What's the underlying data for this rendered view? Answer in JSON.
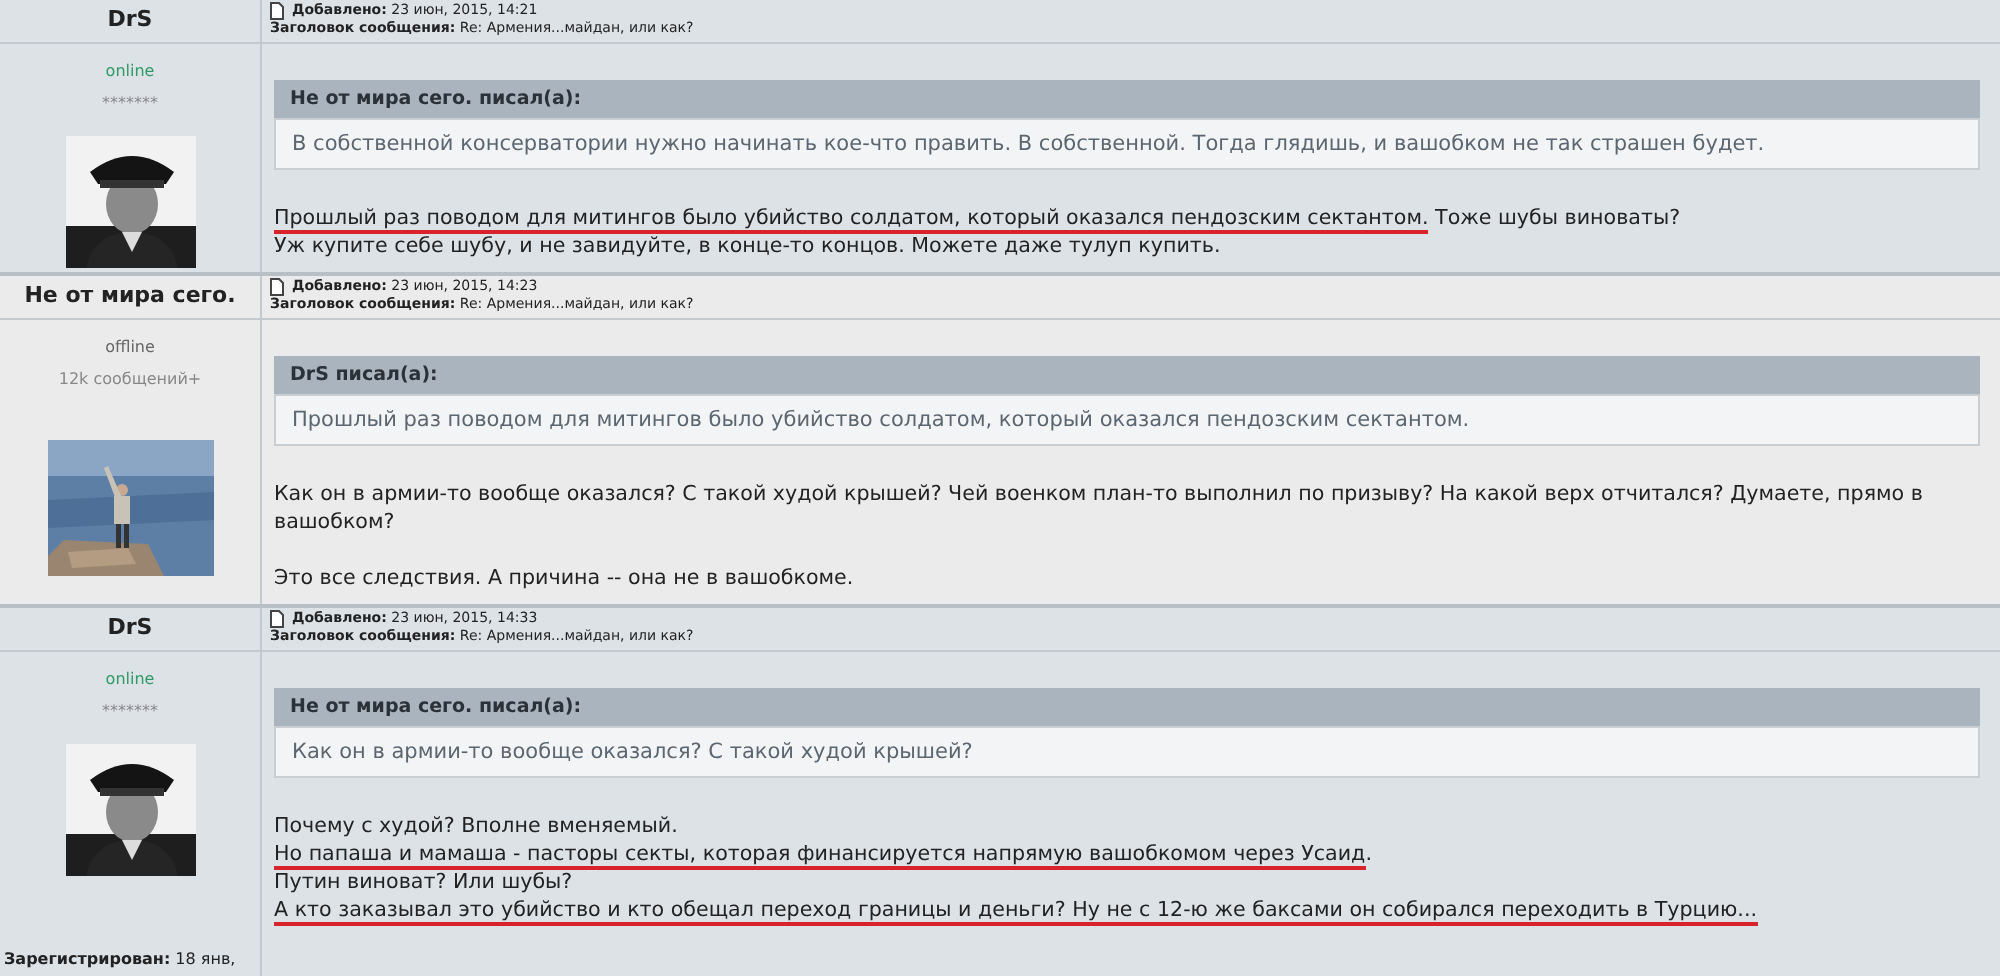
{
  "posts": [
    {
      "author": "DrS",
      "status": "online",
      "rank": "*******",
      "avatar": {
        "kind": "picture"
      },
      "added": "**Добавлено:** 23 июн, 2015, 14:21",
      "subject": "**Заголовок сообщения:** Re: Армения...майдан, или как?",
      "quote": {
        "author": "Не от мира сего. писал(а):",
        "text": "В собственной консерватории нужно начинать кое-что править. В собственной. Тогда глядишь, и вашобком не так страшен будет."
      },
      "paragraphs": [
        [
          [
            {
              "text": "Прошлый раз поводом для митингов было убийство солдатом, который оказался пендозским сектантом.",
              "underlined": true
            },
            {
              "text": " Тоже шубы виноваты?",
              "underlined": false
            }
          ],
          [
            {
              "text": "Уж купите себе шубу, и не завидуйте, в конце-то концов. Можете даже тулуп купить.",
              "underlined": false
            }
          ]
        ]
      ]
    },
    {
      "author": "Не от мира сего.",
      "status": "offline",
      "rank": "12k сообщений+",
      "avatar": {
        "kind": "picture"
      },
      "added": "**Добавлено:** 23 июн, 2015, 14:23",
      "subject": "**Заголовок сообщения:** Re: Армения...майдан, или как?",
      "quote": {
        "author": "DrS писал(а):",
        "text": "Прошлый раз поводом для митингов было убийство солдатом, который оказался пендозским сектантом."
      },
      "paragraphs": [
        [
          [
            {
              "text": "Как он в армии-то вообще оказался? С такой худой крышей? Чей военком план-то выполнил по призыву? На какой верх отчитался? Думаете, прямо в вашобком?",
              "underlined": false
            }
          ]
        ],
        [
          [
            {
              "text": "Это все следствия. А причина -- она не в вашобкоме.",
              "underlined": false
            }
          ]
        ]
      ]
    },
    {
      "author": "DrS",
      "status": "online",
      "rank": "*******",
      "avatar": {
        "kind": "picture"
      },
      "added": "**Добавлено:** 23 июн, 2015, 14:33",
      "subject": "**Заголовок сообщения:** Re: Армения...майдан, или как?",
      "registered": "**Зарегистрирован:** 18 янв,",
      "quote": {
        "author": "Не от мира сего. писал(а):",
        "text": "Как он в армии-то вообще оказался? С такой худой крышей?"
      },
      "paragraphs": [
        [
          [
            {
              "text": "Почему с худой? Вполне вменяемый.",
              "underlined": false
            }
          ],
          [
            {
              "text": "Но папаша и мамаша - пасторы секты, которая финансируется напрямую вашобкомом через Усаид",
              "underlined": true
            },
            {
              "text": ".",
              "underlined": false
            }
          ],
          [
            {
              "text": "Путин виноват? Или шубы?",
              "underlined": false
            }
          ],
          [
            {
              "text": "А кто заказывал это убийство и кто обещал переход границы и деньги? Ну не с 12-ю же баксами он собирался переходить в Турцию...",
              "underlined": true
            }
          ]
        ]
      ]
    }
  ]
}
